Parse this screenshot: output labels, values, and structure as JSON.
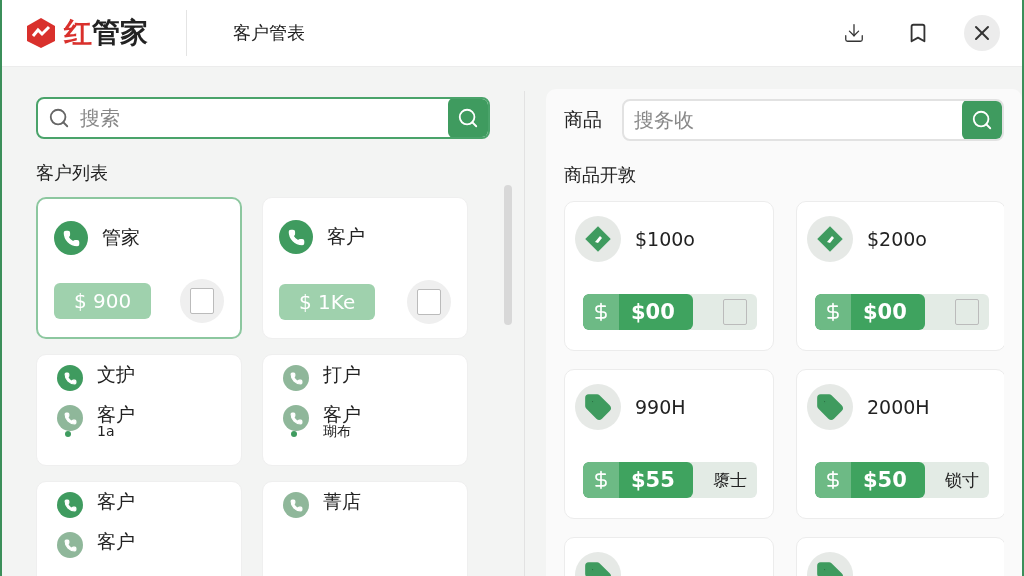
{
  "app": {
    "logo": "红管家",
    "title": "客户管表"
  },
  "customers": {
    "search": {
      "placeholder": "搜索"
    },
    "heading": "客户列表",
    "cards": [
      {
        "kind": "priced",
        "name": "管家",
        "amount": "$ 900",
        "checked": false,
        "selected": true
      },
      {
        "kind": "priced",
        "name": "客户",
        "amount": "$ 1Ke",
        "checked": false,
        "selected": false
      },
      {
        "kind": "lines",
        "selected": false,
        "lines": [
          {
            "text": "文护",
            "muted": false
          },
          {
            "text": "客户",
            "sub": "1a",
            "muted": true
          }
        ]
      },
      {
        "kind": "lines",
        "selected": false,
        "lines": [
          {
            "text": "打户",
            "muted": true
          },
          {
            "text": "客户",
            "sub": "瑚布",
            "muted": true
          }
        ]
      },
      {
        "kind": "lines",
        "selected": false,
        "lines": [
          {
            "text": "客户",
            "muted": false
          },
          {
            "text": "客户",
            "muted": true
          }
        ]
      },
      {
        "kind": "lines",
        "selected": false,
        "lines": [
          {
            "text": "菁店",
            "muted": true
          }
        ]
      }
    ]
  },
  "products": {
    "label": "商品",
    "search": {
      "placeholder": "搜务收"
    },
    "heading": "商品开敦",
    "cards": [
      {
        "kind": "diamond",
        "title": "$100o",
        "amount": "$00",
        "tail": {
          "kind": "checkbox",
          "checked": false
        }
      },
      {
        "kind": "diamond",
        "title": "$200o",
        "amount": "$00",
        "tail": {
          "kind": "checkbox",
          "checked": false
        }
      },
      {
        "kind": "tag",
        "title": "990H",
        "amount": "$55",
        "tail": {
          "kind": "text",
          "text": "隳士"
        }
      },
      {
        "kind": "tag",
        "title": "2000H",
        "amount": "$50",
        "tail": {
          "kind": "text",
          "text": "锁寸"
        }
      },
      {
        "kind": "stub"
      },
      {
        "kind": "stub"
      }
    ]
  }
}
